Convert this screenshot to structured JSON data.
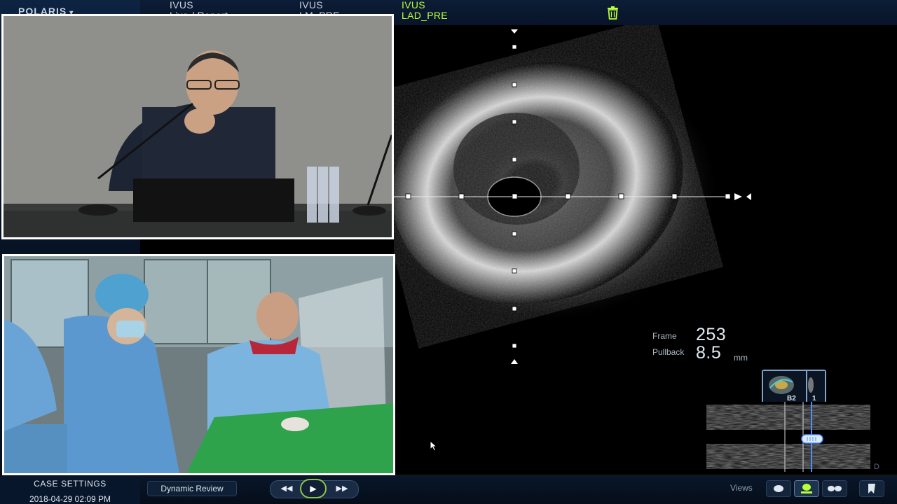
{
  "app": {
    "brand": "POLARIS",
    "brand_caret": "▾"
  },
  "tabs": [
    {
      "line1": "IVUS",
      "line2": "Live / Report",
      "active": false
    },
    {
      "line1": "IVUS",
      "line2": "LM_PRE",
      "active": false
    },
    {
      "line1": "IVUS",
      "line2": "LAD_PRE",
      "active": true
    }
  ],
  "icons": {
    "trash": "trash-icon",
    "play": "▶",
    "rewind": "◀◀",
    "forward": "▶▶"
  },
  "readout": {
    "frame_label": "Frame",
    "frame_value": "253",
    "pullback_label": "Pullback",
    "pullback_value": "8.5",
    "pullback_unit": "mm"
  },
  "thumbnail": {
    "left_label": "B2",
    "right_label": "1"
  },
  "long_view_marker": "D",
  "case": {
    "settings_label": "CASE SETTINGS",
    "datetime": "2018-04-29 02:09 PM"
  },
  "toolbar": {
    "dynamic_review": "Dynamic Review",
    "views_label": "Views"
  },
  "colors": {
    "accent_active_tab": "#b9ff3a",
    "play_ring": "#8bc34a",
    "long_cursor": "#4a90ff"
  }
}
